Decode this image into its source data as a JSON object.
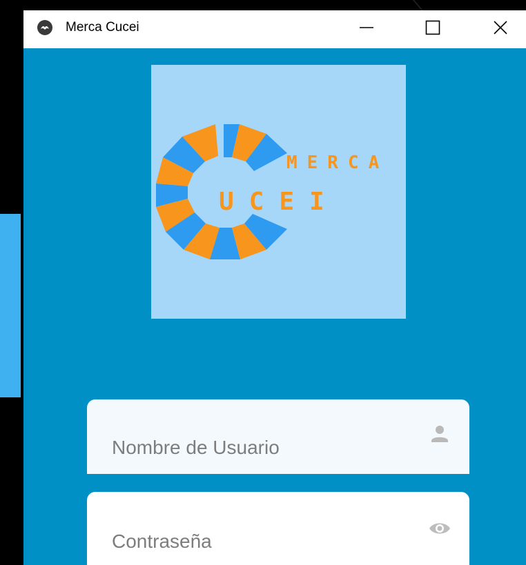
{
  "window": {
    "title": "Merca Cucei",
    "controls": {
      "minimize_icon": "minimize-icon",
      "maximize_icon": "maximize-icon",
      "close_icon": "close-icon"
    }
  },
  "logo": {
    "word_top": "MERCA",
    "word_bottom": "UCEI",
    "colors": {
      "background": "#a6d7f9",
      "orange": "#f7951d",
      "blue": "#2f9bf0"
    }
  },
  "login": {
    "username": {
      "placeholder": "Nombre de Usuario",
      "value": "",
      "icon": "user-icon"
    },
    "password": {
      "placeholder": "Contraseña",
      "value": "",
      "icon": "eye-icon"
    }
  },
  "colors": {
    "window_bg": "#0090c6",
    "titlebar_bg": "#ffffff",
    "input_bg": "#f3f9fd"
  }
}
